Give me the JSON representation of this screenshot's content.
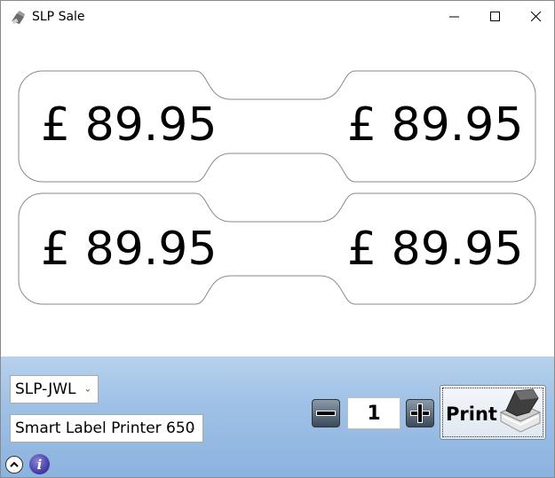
{
  "window": {
    "title": "SLP Sale",
    "app_icon": "label-printer-icon",
    "controls": [
      "minimize-icon",
      "maximize-icon",
      "close-icon"
    ]
  },
  "labels": {
    "rows": [
      {
        "left_price": "£ 89.95",
        "right_price": "£ 89.95"
      },
      {
        "left_price": "£ 89.95",
        "right_price": "£ 89.95"
      }
    ]
  },
  "controls": {
    "label_type": {
      "selected": "SLP-JWL"
    },
    "printer": {
      "selected": "Smart Label Printer 650"
    },
    "quantity": "1",
    "print_label": "Print"
  },
  "footer": {
    "collapse_icon": "chevron-up-icon",
    "info_icon": "info-icon",
    "info_glyph": "i"
  },
  "colors": {
    "panel_top": "#b7d1ed",
    "panel_bottom": "#8bb3df",
    "label_border": "#8a8a8a"
  }
}
